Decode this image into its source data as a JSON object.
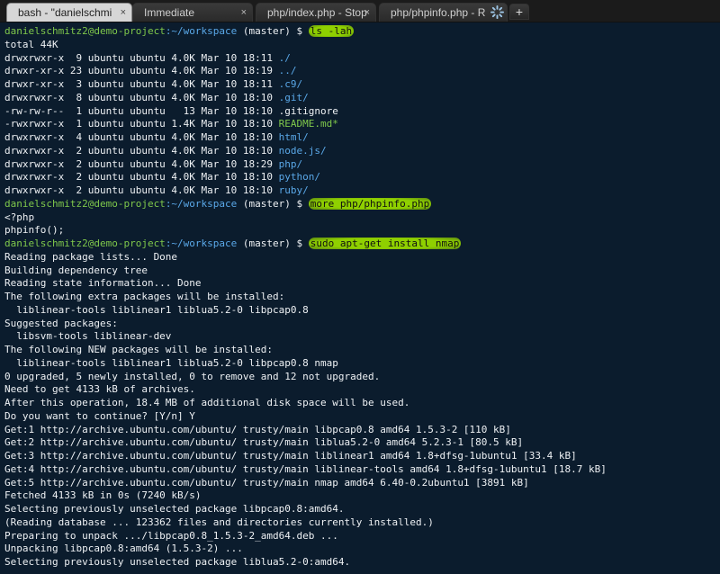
{
  "tabs": [
    {
      "label": "bash - \"danielschmi",
      "close": "×",
      "active": true
    },
    {
      "label": "Immediate",
      "close": "×",
      "active": false
    },
    {
      "label": "php/index.php - Stop",
      "close": "×",
      "active": false
    },
    {
      "label": "php/phpinfo.php - R",
      "close": "",
      "active": false
    }
  ],
  "new_tab_label": "+",
  "colors": {
    "prompt": "#7fc84b",
    "path": "#5aa8e8",
    "highlight": "#8fd000",
    "background": "#0b1c2d"
  },
  "prompt": {
    "user": "danielschmitz2@demo-project",
    "path": ":~/workspace",
    "branch": " (master) $ "
  },
  "commands": [
    "ls -lah",
    "more php/phpinfo.php",
    "sudo apt-get install nmap"
  ],
  "ls_total": "total 44K",
  "ls_rows": [
    {
      "meta": "drwxrwxr-x  9 ubuntu ubuntu 4.0K Mar 10 18:11 ",
      "name": "./",
      "style": "blue"
    },
    {
      "meta": "drwxr-xr-x 23 ubuntu ubuntu 4.0K Mar 10 18:19 ",
      "name": "../",
      "style": "blue"
    },
    {
      "meta": "drwxr-xr-x  3 ubuntu ubuntu 4.0K Mar 10 18:11 ",
      "name": ".c9/",
      "style": "blue"
    },
    {
      "meta": "drwxrwxr-x  8 ubuntu ubuntu 4.0K Mar 10 18:10 ",
      "name": ".git/",
      "style": "blue"
    },
    {
      "meta": "-rw-rw-r--  1 ubuntu ubuntu   13 Mar 10 18:10 ",
      "name": ".gitignore",
      "style": "plain"
    },
    {
      "meta": "-rwxrwxr-x  1 ubuntu ubuntu 1.4K Mar 10 18:10 ",
      "name": "README.md*",
      "style": "green"
    },
    {
      "meta": "drwxrwxr-x  4 ubuntu ubuntu 4.0K Mar 10 18:10 ",
      "name": "html/",
      "style": "blue"
    },
    {
      "meta": "drwxrwxr-x  2 ubuntu ubuntu 4.0K Mar 10 18:10 ",
      "name": "node.js/",
      "style": "blue"
    },
    {
      "meta": "drwxrwxr-x  2 ubuntu ubuntu 4.0K Mar 10 18:29 ",
      "name": "php/",
      "style": "blue"
    },
    {
      "meta": "drwxrwxr-x  2 ubuntu ubuntu 4.0K Mar 10 18:10 ",
      "name": "python/",
      "style": "blue"
    },
    {
      "meta": "drwxrwxr-x  2 ubuntu ubuntu 4.0K Mar 10 18:10 ",
      "name": "ruby/",
      "style": "blue"
    }
  ],
  "php_output": [
    "<?php",
    "phpinfo();"
  ],
  "apt_output": [
    "Reading package lists... Done",
    "Building dependency tree",
    "Reading state information... Done",
    "The following extra packages will be installed:",
    "  liblinear-tools liblinear1 liblua5.2-0 libpcap0.8",
    "Suggested packages:",
    "  libsvm-tools liblinear-dev",
    "The following NEW packages will be installed:",
    "  liblinear-tools liblinear1 liblua5.2-0 libpcap0.8 nmap",
    "0 upgraded, 5 newly installed, 0 to remove and 12 not upgraded.",
    "Need to get 4133 kB of archives.",
    "After this operation, 18.4 MB of additional disk space will be used.",
    "Do you want to continue? [Y/n] Y",
    "Get:1 http://archive.ubuntu.com/ubuntu/ trusty/main libpcap0.8 amd64 1.5.3-2 [110 kB]",
    "Get:2 http://archive.ubuntu.com/ubuntu/ trusty/main liblua5.2-0 amd64 5.2.3-1 [80.5 kB]",
    "Get:3 http://archive.ubuntu.com/ubuntu/ trusty/main liblinear1 amd64 1.8+dfsg-1ubuntu1 [33.4 kB]",
    "Get:4 http://archive.ubuntu.com/ubuntu/ trusty/main liblinear-tools amd64 1.8+dfsg-1ubuntu1 [18.7 kB]",
    "Get:5 http://archive.ubuntu.com/ubuntu/ trusty/main nmap amd64 6.40-0.2ubuntu1 [3891 kB]",
    "Fetched 4133 kB in 0s (7240 kB/s)",
    "Selecting previously unselected package libpcap0.8:amd64.",
    "(Reading database ... 123362 files and directories currently installed.)",
    "Preparing to unpack .../libpcap0.8_1.5.3-2_amd64.deb ...",
    "Unpacking libpcap0.8:amd64 (1.5.3-2) ...",
    "Selecting previously unselected package liblua5.2-0:amd64."
  ]
}
